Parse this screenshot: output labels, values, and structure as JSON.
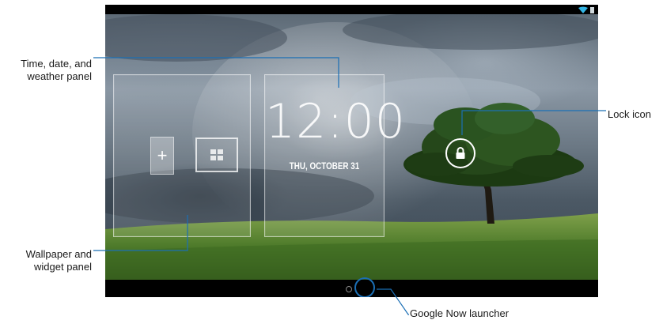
{
  "screen": {
    "clock": {
      "time": "12:00",
      "date": "THU, OCTOBER 31"
    },
    "widget_panel": {
      "add_symbol": "+"
    }
  },
  "icons": {
    "wifi": "wifi-icon",
    "battery": "battery-icon",
    "lock": "lock-icon",
    "add": "add-widget-icon",
    "wallpaper": "wallpaper-icon",
    "google_now": "google-now-launcher-icon"
  },
  "callouts": {
    "time_date_weather": [
      "Time, date, and",
      "weather panel"
    ],
    "wallpaper_widget": [
      "Wallpaper and",
      "widget panel"
    ],
    "lock_icon": "Lock icon",
    "google_now": "Google Now launcher"
  },
  "colors": {
    "callout_line": "#1b6fb5",
    "status_accent": "#33b5e5"
  }
}
